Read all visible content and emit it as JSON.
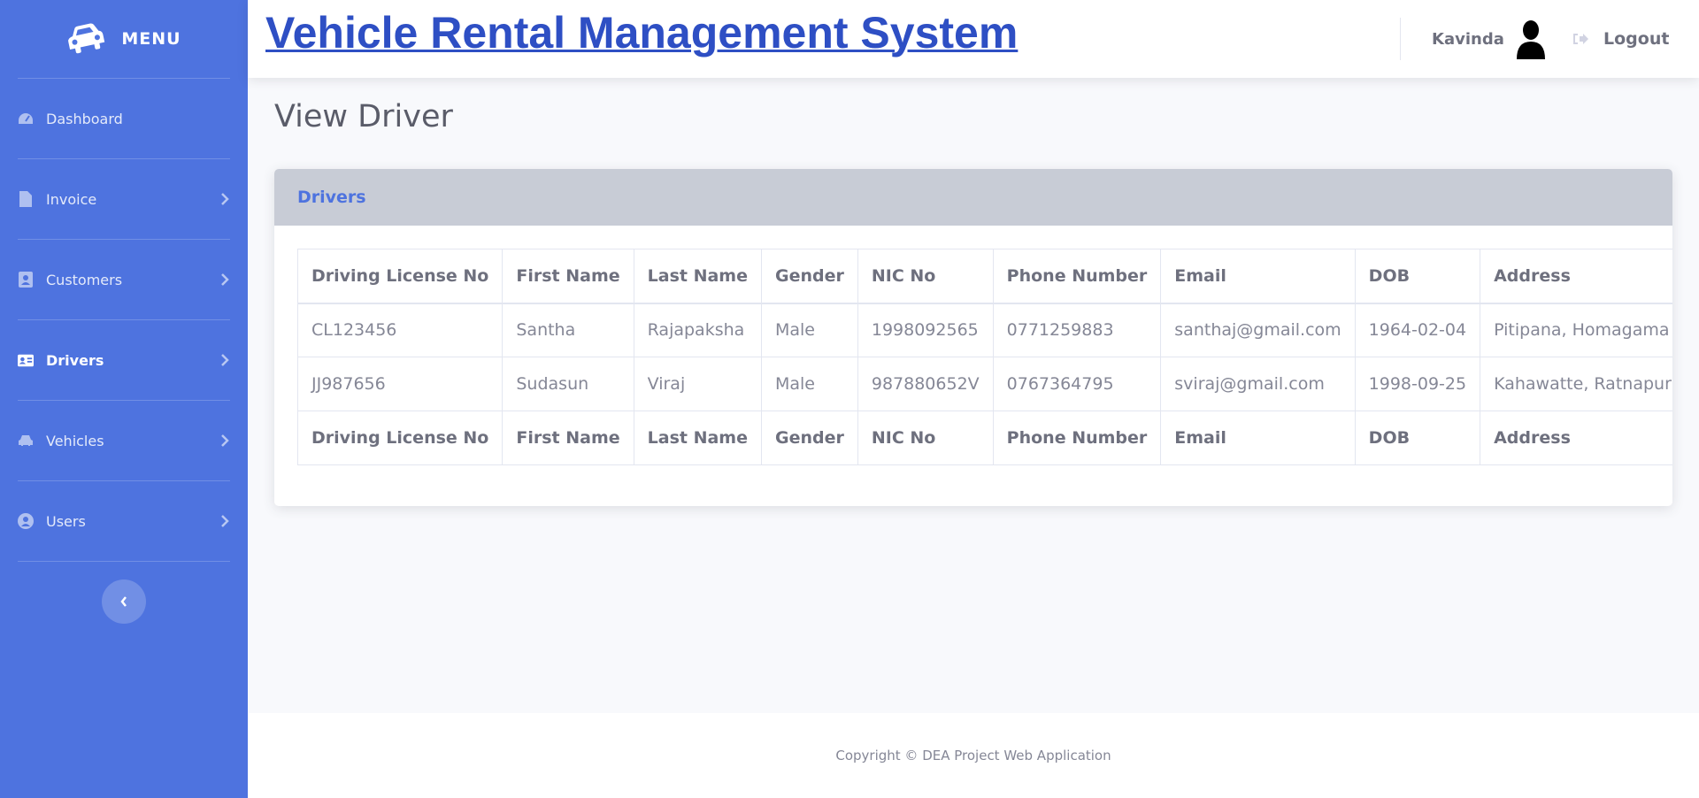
{
  "app": {
    "title": "Vehicle Rental Management System"
  },
  "sidebar": {
    "brand_label": "MENU",
    "brand_icon": "car-icon",
    "items": [
      {
        "label": "Dashboard",
        "icon": "tachometer-icon",
        "has_chevron": false,
        "active": false
      },
      {
        "label": "Invoice",
        "icon": "file-icon",
        "has_chevron": true,
        "active": false
      },
      {
        "label": "Customers",
        "icon": "address-book-icon",
        "has_chevron": true,
        "active": false
      },
      {
        "label": "Drivers",
        "icon": "id-card-icon",
        "has_chevron": true,
        "active": true
      },
      {
        "label": "Vehicles",
        "icon": "car-icon",
        "has_chevron": true,
        "active": false
      },
      {
        "label": "Users",
        "icon": "user-circle-icon",
        "has_chevron": true,
        "active": false
      }
    ],
    "toggle_icon": "chevron-left-icon"
  },
  "topbar": {
    "user_name": "Kavinda",
    "avatar_icon": "user-silhouette-icon",
    "logout_label": "Logout",
    "logout_icon": "sign-out-icon"
  },
  "main": {
    "page_title": "View Driver",
    "card_title": "Drivers",
    "table": {
      "columns": [
        "Driving License No",
        "First Name",
        "Last Name",
        "Gender",
        "NIC No",
        "Phone Number",
        "Email",
        "DOB",
        "Address"
      ],
      "rows": [
        [
          "CL123456",
          "Santha",
          "Rajapaksha",
          "Male",
          "1998092565",
          "0771259883",
          "santhaj@gmail.com",
          "1964-02-04",
          "Pitipana, Homagama"
        ],
        [
          "JJ987656",
          "Sudasun",
          "Viraj",
          "Male",
          "987880652V",
          "0767364795",
          "sviraj@gmail.com",
          "1998-09-25",
          "Kahawatte, Ratnapura"
        ]
      ]
    }
  },
  "footer": {
    "copyright": "Copyright © DEA Project Web Application"
  },
  "colors": {
    "sidebar": "#4e73df",
    "title": "#2e4fc4",
    "card_header": "#c8ccd6",
    "background": "#f8f9fc"
  }
}
